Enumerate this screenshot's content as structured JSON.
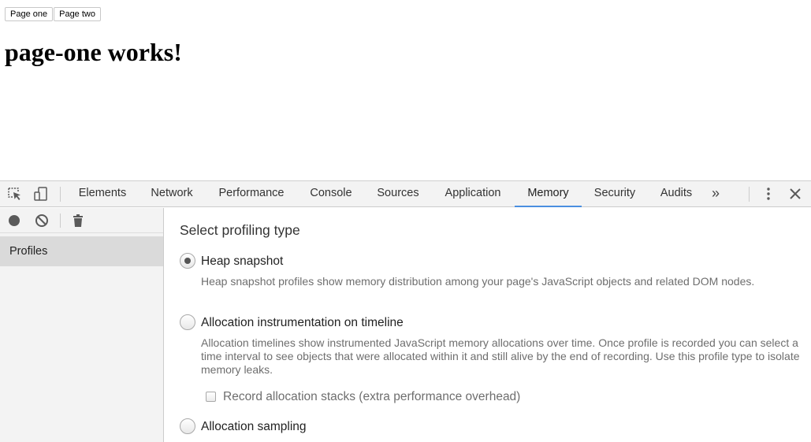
{
  "page": {
    "buttons": [
      "Page one",
      "Page two"
    ],
    "heading": "page-one works!"
  },
  "devtools": {
    "toolbar": {
      "inspect_icon": "inspect-element-icon",
      "device_icon": "device-toolbar-icon",
      "tabs": [
        {
          "label": "Elements",
          "active": false
        },
        {
          "label": "Network",
          "active": false
        },
        {
          "label": "Performance",
          "active": false
        },
        {
          "label": "Console",
          "active": false
        },
        {
          "label": "Sources",
          "active": false
        },
        {
          "label": "Application",
          "active": false
        },
        {
          "label": "Memory",
          "active": true
        },
        {
          "label": "Security",
          "active": false
        },
        {
          "label": "Audits",
          "active": false
        }
      ],
      "more_tabs": "»",
      "menu_icon": "kebab-menu-icon",
      "close_icon": "close-icon",
      "active_tab_color": "#4a8fe0"
    },
    "sidebar": {
      "tools": [
        "record-icon",
        "clear-icon",
        "trash-icon"
      ],
      "items": [
        {
          "label": "Profiles",
          "selected": true
        }
      ]
    },
    "content": {
      "title": "Select profiling type",
      "options": [
        {
          "label": "Heap snapshot",
          "checked": true,
          "description": "Heap snapshot profiles show memory distribution among your page's JavaScript objects and related DOM nodes."
        },
        {
          "label": "Allocation instrumentation on timeline",
          "checked": false,
          "description": "Allocation timelines show instrumented JavaScript memory allocations over time. Once profile is recorded you can select a time interval to see objects that were allocated within it and still alive by the end of recording. Use this profile type to isolate memory leaks.",
          "checkbox": {
            "label": "Record allocation stacks (extra performance overhead)",
            "checked": false
          }
        },
        {
          "label": "Allocation sampling",
          "checked": false
        }
      ]
    }
  }
}
